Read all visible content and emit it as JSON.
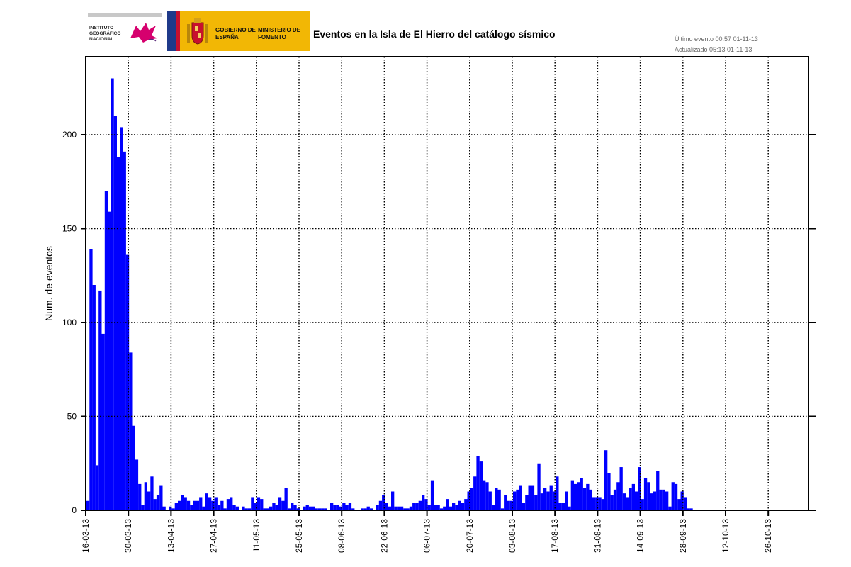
{
  "header": {
    "ign_name": "INSTITUTO GEOGRÁFICO NACIONAL",
    "gob_line": "GOBIERNO DE ESPAÑA",
    "min_line": "MINISTERIO DE FOMENTO",
    "last_event": "Último evento 00:57 01-11-13",
    "updated": "Actualizado    05:13  01-11-13"
  },
  "colors": {
    "bar": "#0000ff",
    "gob_yellow": "#f2b705",
    "ign_magenta": "#d6006e"
  },
  "chart_data": {
    "type": "bar",
    "title": "Eventos en la Isla de El Hierro del catálogo sísmico",
    "xlabel": "",
    "ylabel": "Num. de eventos",
    "ylim": [
      0,
      240
    ],
    "yticks": [
      0,
      50,
      100,
      150,
      200
    ],
    "grid": true,
    "x_start": "16-03-13",
    "x_ticks": [
      "16-03-13",
      "30-03-13",
      "13-04-13",
      "27-04-13",
      "11-05-13",
      "25-05-13",
      "08-06-13",
      "22-06-13",
      "06-07-13",
      "20-07-13",
      "03-08-13",
      "17-08-13",
      "31-08-13",
      "14-09-13",
      "28-09-13",
      "12-10-13",
      "26-10-13"
    ],
    "values": [
      5,
      139,
      120,
      24,
      117,
      94,
      170,
      159,
      230,
      210,
      188,
      204,
      191,
      136,
      84,
      45,
      27,
      14,
      3,
      15,
      10,
      18,
      6,
      8,
      13,
      2,
      0,
      2,
      1,
      4,
      5,
      8,
      7,
      5,
      3,
      5,
      5,
      7,
      2,
      9,
      7,
      5,
      7,
      3,
      5,
      1,
      6,
      7,
      3,
      2,
      0,
      2,
      1,
      1,
      7,
      4,
      7,
      6,
      1,
      1,
      2,
      4,
      3,
      7,
      5,
      12,
      1,
      4,
      3,
      1,
      0,
      2,
      3,
      2,
      2,
      1,
      1,
      1,
      1,
      0,
      4,
      3,
      3,
      2,
      4,
      3,
      4,
      1,
      0,
      0,
      1,
      1,
      2,
      1,
      0,
      3,
      5,
      8,
      4,
      2,
      10,
      2,
      2,
      2,
      1,
      1,
      2,
      4,
      4,
      5,
      8,
      6,
      3,
      16,
      3,
      3,
      1,
      2,
      6,
      2,
      4,
      3,
      5,
      4,
      6,
      10,
      12,
      18,
      29,
      26,
      16,
      15,
      10,
      3,
      12,
      11,
      1,
      8,
      5,
      5,
      10,
      11,
      13,
      4,
      8,
      13,
      13,
      8,
      25,
      9,
      12,
      10,
      13,
      10,
      18,
      4,
      4,
      10,
      2,
      16,
      14,
      15,
      17,
      12,
      14,
      11,
      7,
      7,
      7,
      6,
      32,
      20,
      8,
      11,
      15,
      23,
      9,
      7,
      12,
      14,
      10,
      23,
      6,
      17,
      15,
      9,
      10,
      21,
      11,
      11,
      10,
      2,
      15,
      14,
      6,
      10,
      7,
      1,
      1
    ]
  }
}
